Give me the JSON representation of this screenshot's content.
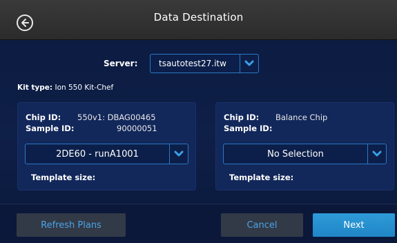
{
  "header": {
    "title": "Data Destination",
    "back_icon": "arrow-left-circle-icon"
  },
  "server": {
    "label": "Server:",
    "value": "tsautotest27.itw"
  },
  "kit": {
    "label": "Kit type:",
    "value": "Ion 550 Kit-Chef"
  },
  "chips": [
    {
      "chip_id_label": "Chip ID:",
      "chip_id_value": "550v1: DBAG00465",
      "sample_id_label": "Sample ID:",
      "sample_id_value": "90000051",
      "plan_value": "2DE60 - runA1001",
      "template_size_label": "Template size:"
    },
    {
      "chip_id_label": "Chip ID:",
      "chip_id_value": "Balance Chip",
      "sample_id_label": "Sample ID:",
      "sample_id_value": "",
      "plan_value": "No Selection",
      "template_size_label": "Template size:"
    }
  ],
  "footer": {
    "refresh_label": "Refresh Plans",
    "cancel_label": "Cancel",
    "next_label": "Next"
  },
  "colors": {
    "accent": "#2a79c4",
    "header_bg": "#333333",
    "background": "#0e1f48",
    "next_button": "#2590cf",
    "link_text": "#4aa3e8"
  }
}
